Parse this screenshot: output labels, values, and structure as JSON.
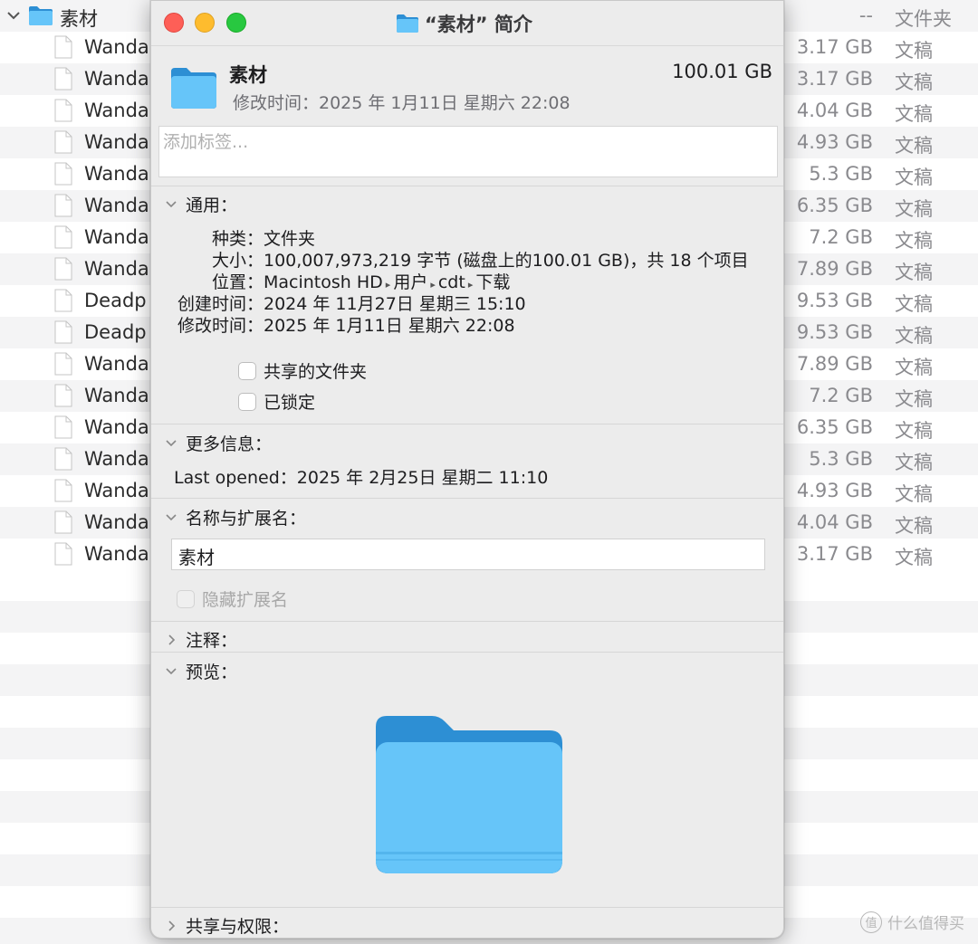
{
  "finder": {
    "folder_row": {
      "name": "素材",
      "size": "--",
      "kind": "文件夹"
    },
    "files": [
      {
        "name": "Wanda",
        "size": "3.17 GB",
        "kind": "文稿"
      },
      {
        "name": "Wanda",
        "size": "3.17 GB",
        "kind": "文稿"
      },
      {
        "name": "Wanda",
        "size": "4.04 GB",
        "kind": "文稿"
      },
      {
        "name": "Wanda",
        "size": "4.93 GB",
        "kind": "文稿"
      },
      {
        "name": "Wanda",
        "size": "5.3 GB",
        "kind": "文稿"
      },
      {
        "name": "Wanda",
        "size": "6.35 GB",
        "kind": "文稿"
      },
      {
        "name": "Wanda",
        "size": "7.2 GB",
        "kind": "文稿"
      },
      {
        "name": "Wanda",
        "size": "7.89 GB",
        "kind": "文稿"
      },
      {
        "name": "Deadp",
        "size": "9.53 GB",
        "kind": "文稿"
      },
      {
        "name": "Deadp",
        "size": "9.53 GB",
        "kind": "文稿"
      },
      {
        "name": "Wanda",
        "size": "7.89 GB",
        "kind": "文稿"
      },
      {
        "name": "Wanda",
        "size": "7.2 GB",
        "kind": "文稿"
      },
      {
        "name": "Wanda",
        "size": "6.35 GB",
        "kind": "文稿"
      },
      {
        "name": "Wanda",
        "size": "5.3 GB",
        "kind": "文稿"
      },
      {
        "name": "Wanda",
        "size": "4.93 GB",
        "kind": "文稿"
      },
      {
        "name": "Wanda",
        "size": "4.04 GB",
        "kind": "文稿"
      },
      {
        "name": "Wanda",
        "size": "3.17 GB",
        "kind": "文稿"
      }
    ]
  },
  "info": {
    "window_title": "“素材” 简介",
    "header": {
      "name": "素材",
      "size": "100.01 GB",
      "modified": "修改时间：2025 年 1月11日 星期六 22:08"
    },
    "tags_placeholder": "添加标签...",
    "general": {
      "title": "通用：",
      "kind_label": "种类：",
      "kind_value": "文件夹",
      "size_label": "大小：",
      "size_value": "100,007,973,219 字节 (磁盘上的100.01 GB)，共 18 个项目",
      "where_label": "位置：",
      "where_path": [
        "Macintosh HD",
        "用户",
        "cdt",
        "下载"
      ],
      "created_label": "创建时间：",
      "created_value": "2024 年 11月27日 星期三 15:10",
      "modified_label": "修改时间：",
      "modified_value": "2025 年 1月11日 星期六 22:08",
      "shared_folder_label": "共享的文件夹",
      "locked_label": "已锁定"
    },
    "more_info": {
      "title": "更多信息：",
      "last_opened": "Last opened：2025 年 2月25日 星期二 11:10"
    },
    "name_ext": {
      "title": "名称与扩展名：",
      "value": "素材",
      "hide_ext_label": "隐藏扩展名"
    },
    "comments_title": "注释：",
    "preview_title": "预览：",
    "sharing_title": "共享与权限："
  },
  "watermark": {
    "badge": "值",
    "text": "什么值得买"
  },
  "colors": {
    "folder_light": "#66c5f9",
    "folder_dark": "#2d8fd4",
    "traffic_red": "#fe5f57",
    "traffic_yellow": "#febc2e",
    "traffic_green": "#28c840"
  }
}
